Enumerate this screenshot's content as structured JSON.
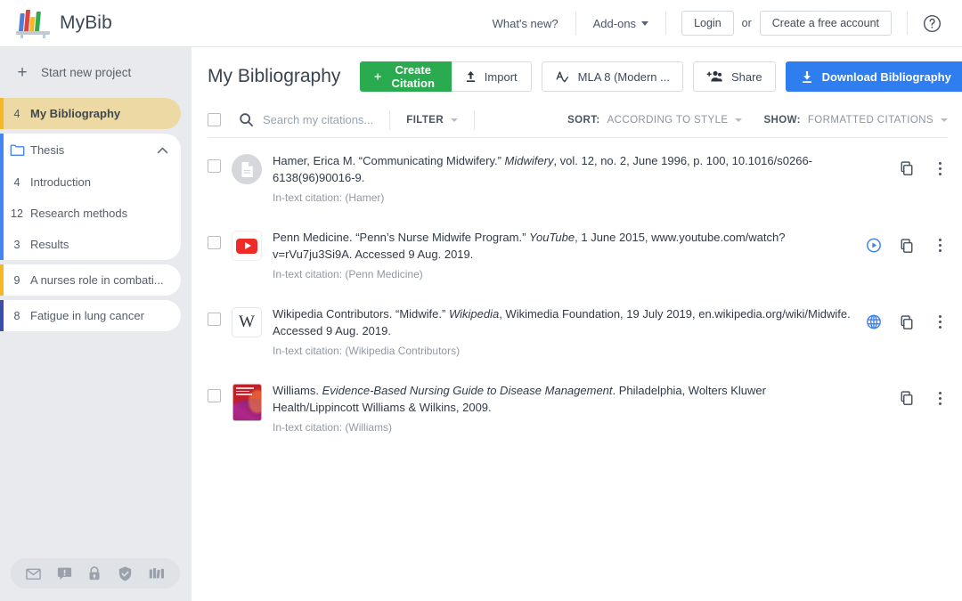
{
  "header": {
    "brand": "MyBib",
    "logo_icon": "bookshelf-logo",
    "whats_new": "What's new?",
    "addons": "Add-ons",
    "login": "Login",
    "or": "or",
    "create_account": "Create a free account",
    "help_icon": "help-circle-icon"
  },
  "sidebar": {
    "new_project": "Start new project",
    "new_project_icon": "plus-icon",
    "active_project": {
      "count": "4",
      "label": "My Bibliography",
      "accent": "#f5b724"
    },
    "group": {
      "title": "Thesis",
      "folder_icon": "folder-icon",
      "chevron_icon": "chevron-up-icon",
      "accent": "#4285f4",
      "children": [
        {
          "count": "4",
          "label": "Introduction"
        },
        {
          "count": "12",
          "label": "Research methods"
        },
        {
          "count": "3",
          "label": "Results"
        }
      ]
    },
    "projects": [
      {
        "count": "9",
        "label": "A nurses role in combati...",
        "accent": "#f5b724"
      },
      {
        "count": "8",
        "label": "Fatigue in lung cancer",
        "accent": "#3b4fa8"
      }
    ],
    "footer_icons": [
      "mail-icon",
      "feedback-icon",
      "lock-icon",
      "shield-check-icon",
      "books-icon"
    ]
  },
  "toolbar": {
    "page_title": "My Bibliography",
    "create_citation": "Create Citation",
    "create_citation_icon": "plus-icon",
    "create_citation_color": "#2aab4f",
    "import": "Import",
    "import_icon": "upload-icon",
    "style": "MLA 8 (Modern ...",
    "style_icon": "style-check-icon",
    "share": "Share",
    "share_icon": "add-person-icon",
    "download": "Download Bibliography",
    "download_icon": "download-icon",
    "download_color": "#2f7ef0"
  },
  "filterbar": {
    "search_placeholder": "Search my citations...",
    "search_icon": "search-icon",
    "filter_label": "FILTER",
    "sort_label": "SORT:",
    "sort_value": "ACCORDING TO STYLE",
    "show_label": "SHOW:",
    "show_value": "FORMATTED CITATIONS"
  },
  "citations": [
    {
      "icon": "document-icon",
      "source_type": "journal",
      "text_html": "Hamer, Erica M. “Communicating Midwifery.” <em>Midwifery</em>, vol. 12, no. 2, June 1996, p. 100, 10.1016/s0266-6138(96)90016-9.",
      "intext": "In-text citation: (Hamer)",
      "has_preview": false,
      "preview_icon": "",
      "copy_icon": "copy-icon",
      "menu_icon": "more-vertical-icon"
    },
    {
      "icon": "youtube-icon",
      "source_type": "video",
      "text_html": "Penn Medicine. “Penn’s Nurse Midwife Program.” <em>YouTube</em>, 1 June 2015, www.youtube.com/watch?v=rVu7ju3Si9A. Accessed 9 Aug. 2019.",
      "intext": "In-text citation: (Penn Medicine)",
      "has_preview": true,
      "preview_icon": "play-circle-icon",
      "copy_icon": "copy-icon",
      "menu_icon": "more-vertical-icon"
    },
    {
      "icon": "wikipedia-icon",
      "source_type": "website",
      "text_html": "Wikipedia Contributors. “Midwife.” <em>Wikipedia</em>, Wikimedia Foundation, 19 July 2019, en.wikipedia.org/wiki/Midwife. Accessed 9 Aug. 2019.",
      "intext": "In-text citation: (Wikipedia Contributors)",
      "has_preview": true,
      "preview_icon": "globe-icon",
      "copy_icon": "copy-icon",
      "menu_icon": "more-vertical-icon"
    },
    {
      "icon": "book-cover-icon",
      "source_type": "book",
      "text_html": "Williams. <em>Evidence-Based Nursing Guide to Disease Management</em>. Philadelphia, Wolters Kluwer Health/Lippincott Williams &amp; Wilkins, 2009.",
      "intext": "In-text citation: (Williams)",
      "has_preview": false,
      "preview_icon": "",
      "copy_icon": "copy-icon",
      "menu_icon": "more-vertical-icon"
    }
  ]
}
